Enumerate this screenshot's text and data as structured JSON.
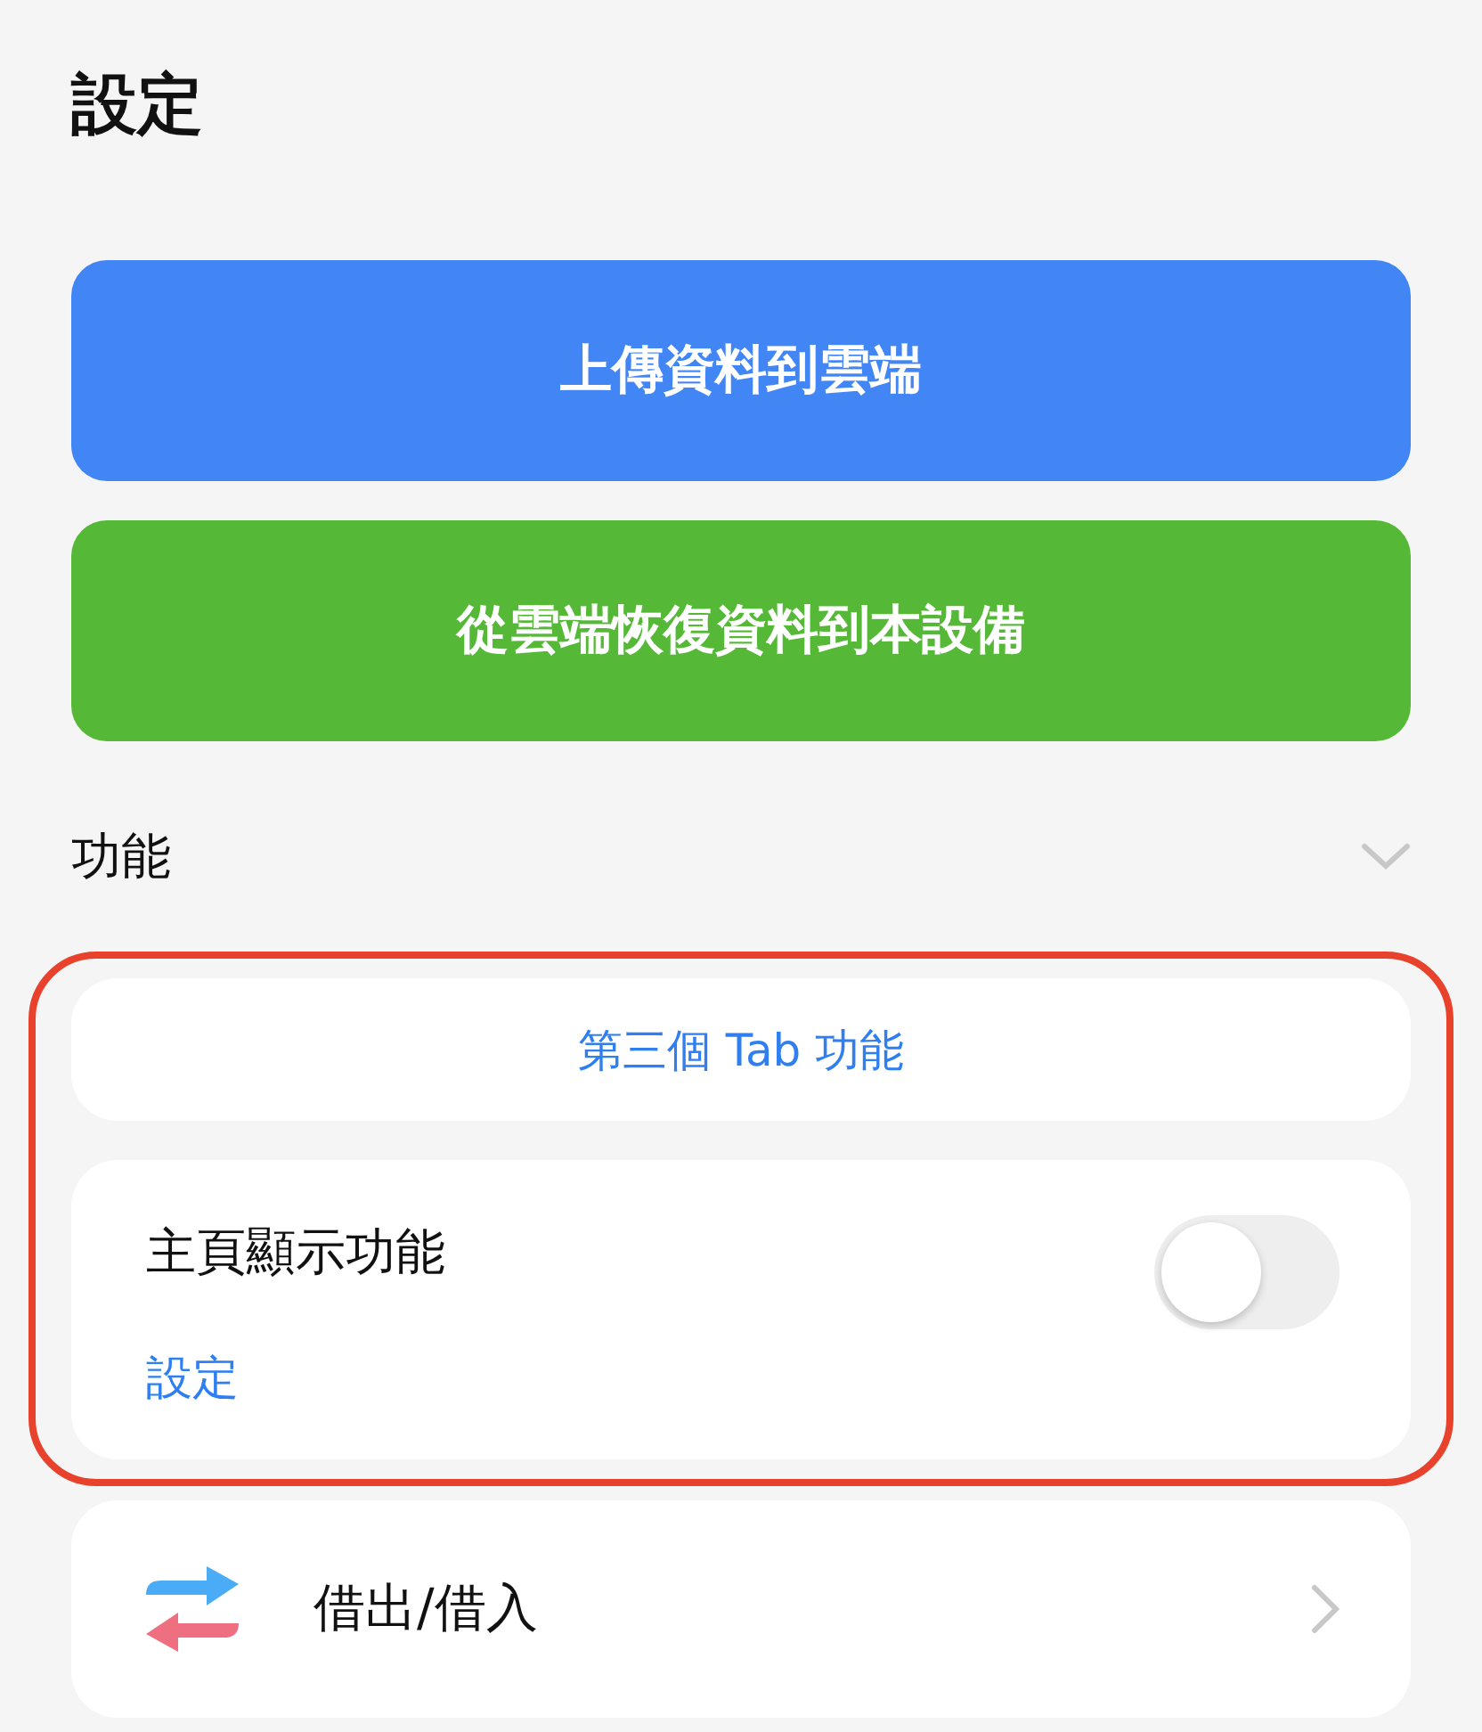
{
  "title": "設定",
  "actions": [
    {
      "label": "上傳資料到雲端",
      "color": "#4285f4"
    },
    {
      "label": "從雲端恢復資料到本設備",
      "color": "#55b837"
    }
  ],
  "section": {
    "title": "功能",
    "expanded": true,
    "highlighted": true,
    "tab_button": "第三個 Tab 功能",
    "home_feature": {
      "label": "主頁顯示功能",
      "on": false,
      "link": "設定"
    }
  },
  "rows": [
    {
      "label": "借出/借入"
    }
  ]
}
